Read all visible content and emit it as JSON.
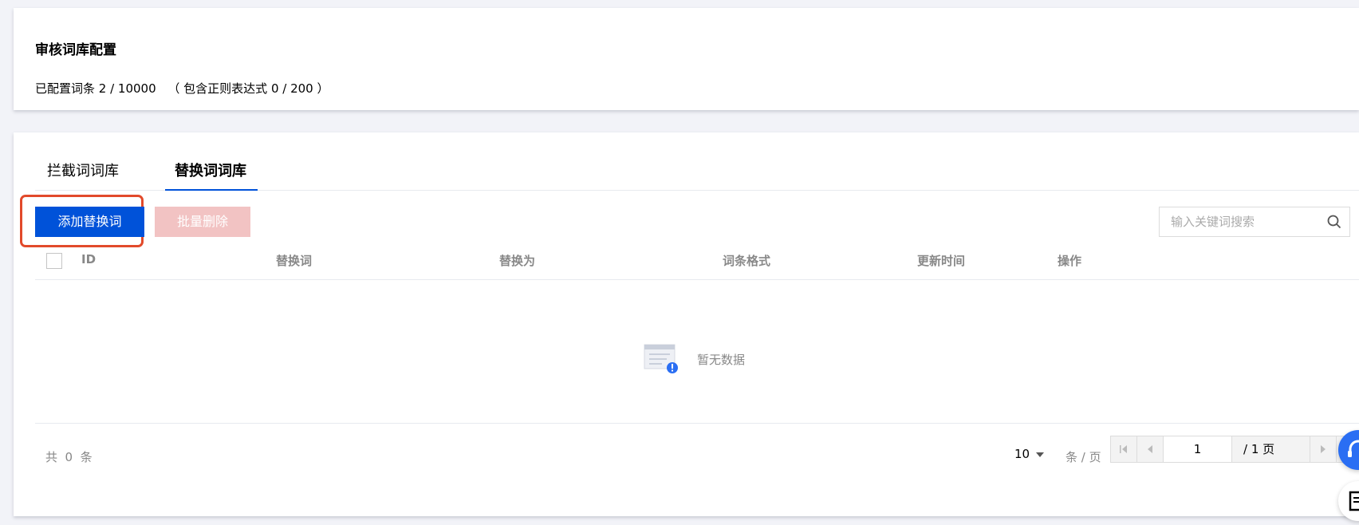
{
  "config": {
    "title": "审核词库配置",
    "summary_label": "已配置词条 2 / 10000",
    "summary_regex": "（ 包含正则表达式 0 / 200 ）"
  },
  "tabs": [
    {
      "label": "拦截词词库",
      "active": false
    },
    {
      "label": "替换词词库",
      "active": true
    }
  ],
  "toolbar": {
    "add_label": "添加替换词",
    "batch_delete_label": "批量删除",
    "search_placeholder": "输入关键词搜索",
    "search_icon": "search-icon"
  },
  "table": {
    "columns": [
      "ID",
      "替换词",
      "替换为",
      "词条格式",
      "更新时间",
      "操作"
    ],
    "rows": [],
    "empty_text": "暂无数据"
  },
  "pagination": {
    "total": "共  0  条",
    "page_size": "10",
    "per_page_suffix": "条 / 页",
    "current_page": "1",
    "total_pages": "/ 1 页"
  },
  "colors": {
    "primary": "#0052d9",
    "highlight": "#e24a2b",
    "disabled_danger": "#f2c3c3"
  }
}
